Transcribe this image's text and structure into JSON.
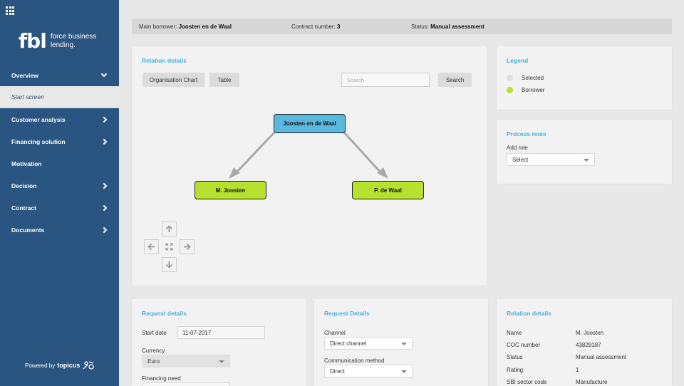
{
  "sidebar": {
    "logo_mark": "fbl",
    "logo_line1": "force business",
    "logo_line2": "lending.",
    "items": [
      {
        "label": "Overview"
      },
      {
        "label": "Start screen"
      },
      {
        "label": "Customer analysis"
      },
      {
        "label": "Financing solution"
      },
      {
        "label": "Motivation"
      },
      {
        "label": "Decision"
      },
      {
        "label": "Contract"
      },
      {
        "label": "Documents"
      }
    ],
    "powered_by": "Powered by",
    "powered_brand": "topicus"
  },
  "info_bar": {
    "borrower_label": "Main borrower:",
    "borrower_value": "Joosten en de Waal",
    "contract_label": "Contract number:",
    "contract_value": "3",
    "status_label": "Status:",
    "status_value": "Manual assessment"
  },
  "relation_panel": {
    "title": "Relation details",
    "org_chart_label": "Organisation Chart",
    "table_label": "Table",
    "search_placeholder": "Search",
    "search_button": "Search",
    "nodes": {
      "root": "Joosten en de Waal",
      "left": "M. Joosten",
      "right": "P. de Waal"
    }
  },
  "legend": {
    "title": "Legend",
    "items": [
      {
        "label": "Selected",
        "color": "#dedede"
      },
      {
        "label": "Borrower",
        "color": "#b6e12e"
      }
    ]
  },
  "process_roles": {
    "title": "Process roles",
    "add_role_label": "Add role",
    "select_value": "Select"
  },
  "request_details": {
    "title": "Request details",
    "start_date_label": "Start date",
    "start_date_value": "11-07-2017",
    "currency_label": "Currency",
    "currency_value": "Euro",
    "financing_need_label": "Financing need"
  },
  "request_details2": {
    "title": "Request Details",
    "channel_label": "Channel",
    "channel_value": "Direct channel",
    "comm_label": "Communication method",
    "comm_value": "Direct"
  },
  "relation_details2": {
    "title": "Relation details",
    "rows": [
      {
        "key": "Name",
        "value": "M. Joosten"
      },
      {
        "key": "COC number",
        "value": "43829187"
      },
      {
        "key": "Status",
        "value": "Manual assessment"
      },
      {
        "key": "Rating",
        "value": "1"
      },
      {
        "key": "SBI sector code",
        "value": "Manufacture"
      }
    ]
  },
  "colors": {
    "sidebar": "#2a5580",
    "accent": "#4ab0d8",
    "borrower": "#b6e12e",
    "selected_node": "#5ab7dd"
  }
}
